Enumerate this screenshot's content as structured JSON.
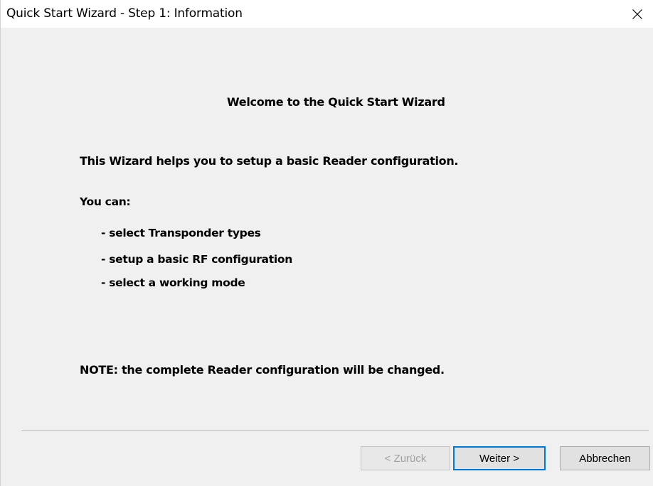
{
  "window": {
    "title": "Quick Start Wizard - Step 1: Information",
    "close_icon": "close-icon"
  },
  "content": {
    "welcome": "Welcome to the Quick Start Wizard",
    "intro": "This Wizard helps you to setup a basic Reader configuration.",
    "you_can": "You can:",
    "bullets": [
      "- select Transponder types",
      "- setup a basic RF configuration",
      "- select a working mode"
    ],
    "note": "NOTE: the complete Reader configuration will be changed."
  },
  "buttons": {
    "back_label": "< Zurück",
    "next_label": "Weiter >",
    "cancel_label": "Abbrechen"
  },
  "colors": {
    "background": "#f0f0f0",
    "titlebar": "#ffffff",
    "focus_border": "#0078d7",
    "disabled_text": "#a0a0a0"
  }
}
